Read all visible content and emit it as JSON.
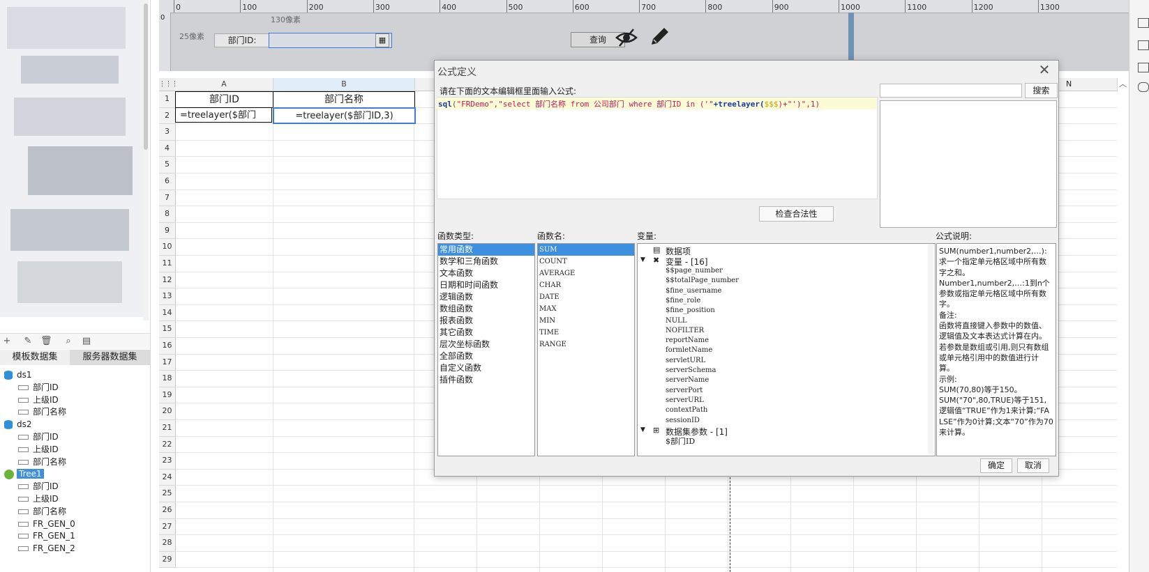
{
  "left_panel": {
    "toolbar_icons": [
      "add-icon",
      "edit-icon",
      "delete-icon",
      "preview-icon",
      "edit-sql-icon"
    ],
    "tabs": [
      "模板数据集",
      "服务器数据集"
    ],
    "tree": [
      {
        "type": "db",
        "label": "ds1"
      },
      {
        "type": "field",
        "label": "部门ID"
      },
      {
        "type": "field",
        "label": "上级ID"
      },
      {
        "type": "field",
        "label": "部门名称"
      },
      {
        "type": "db",
        "label": "ds2"
      },
      {
        "type": "field",
        "label": "部门ID"
      },
      {
        "type": "field",
        "label": "上级ID"
      },
      {
        "type": "field",
        "label": "部门名称"
      },
      {
        "type": "tree",
        "label": "Tree1"
      },
      {
        "type": "field",
        "label": "部门ID"
      },
      {
        "type": "field",
        "label": "上级ID"
      },
      {
        "type": "field",
        "label": "部门名称"
      },
      {
        "type": "field",
        "label": "FR_GEN_0"
      },
      {
        "type": "field",
        "label": "FR_GEN_1"
      },
      {
        "type": "field",
        "label": "FR_GEN_2"
      }
    ]
  },
  "param_area": {
    "ruler_ticks": [
      "0",
      "100",
      "200",
      "300",
      "400",
      "500",
      "600",
      "700",
      "800",
      "900",
      "1000",
      "1100",
      "1200",
      "1300"
    ],
    "ruler_v_tick": "0",
    "width_hint": "130像素",
    "height_hint": "25像素",
    "dept_label": "部门ID:",
    "query_button": "查询"
  },
  "sheet": {
    "columns": [
      "A",
      "B",
      "N"
    ],
    "rows": [
      "1",
      "2",
      "3",
      "4",
      "5",
      "6",
      "7",
      "8",
      "9",
      "10",
      "11",
      "12",
      "13",
      "14",
      "15",
      "16",
      "17",
      "18",
      "19",
      "20",
      "21",
      "22",
      "23",
      "24",
      "25",
      "26",
      "27",
      "28",
      "29"
    ],
    "a1": "部门ID",
    "b1": "部门名称",
    "a2": "=treelayer($部门",
    "b2": "=treelayer($部门ID,3)"
  },
  "dialog": {
    "title": "公式定义",
    "prompt": "请在下面的文本编辑框里面输入公式:",
    "formula": {
      "fn": "sql",
      "arg1": "\"FRDemo\"",
      "arg2_pre": "\"select 部门名称 from 公司部门 where 部门ID in ('\"",
      "concat": "+treelayer(",
      "var": "$$$",
      "tail": ")+\"')\",1)"
    },
    "search_button": "搜索",
    "check_button": "检查合法性",
    "func_type_label": "函数类型:",
    "func_name_label": "函数名:",
    "var_label": "变量:",
    "desc_label": "公式说明:",
    "func_types": [
      "常用函数",
      "数学和三角函数",
      "文本函数",
      "日期和时间函数",
      "逻辑函数",
      "数组函数",
      "报表函数",
      "其它函数",
      "层次坐标函数",
      "全部函数",
      "自定义函数",
      "插件函数"
    ],
    "func_names": [
      "SUM",
      "COUNT",
      "AVERAGE",
      "CHAR",
      "DATE",
      "MAX",
      "MIN",
      "TIME",
      "RANGE"
    ],
    "var_tree": {
      "data_item": "数据项",
      "var_group": "变量 - [16]",
      "vars": [
        "$$page_number",
        "$$totalPage_number",
        "$fine_username",
        "$fine_role",
        "$fine_position",
        "NULL",
        "NOFILTER",
        "reportName",
        "formletName",
        "servletURL",
        "serverSchema",
        "serverName",
        "serverPort",
        "serverURL",
        "contextPath",
        "sessionID"
      ],
      "ds_param_group": "数据集参数 - [1]",
      "ds_params": [
        "$部门ID"
      ]
    },
    "description": "SUM(number1,number2,…):求一个指定单元格区域中所有数字之和。\nNumber1,number2,…:1到n个参数或指定单元格区域中所有数字。\n备注:\n函数将直接键入参数中的数值、逻辑值及文本表达式计算在内。若参数是数组或引用,则只有数组或单元格引用中的数值进行计算。\n示例:\nSUM(70,80)等于150。\nSUM(\"70\",80,TRUE)等于151,逻辑值“TRUE”作为1来计算;“FALSE”作为0计算;文本“70”作为70来计算。",
    "ok_button": "确定",
    "cancel_button": "取消"
  },
  "colors": {
    "selection": "#3d8fe0",
    "formula_highlight": "#fbfbd6",
    "keyword": "#1a38b0",
    "string": "#c2185b"
  }
}
